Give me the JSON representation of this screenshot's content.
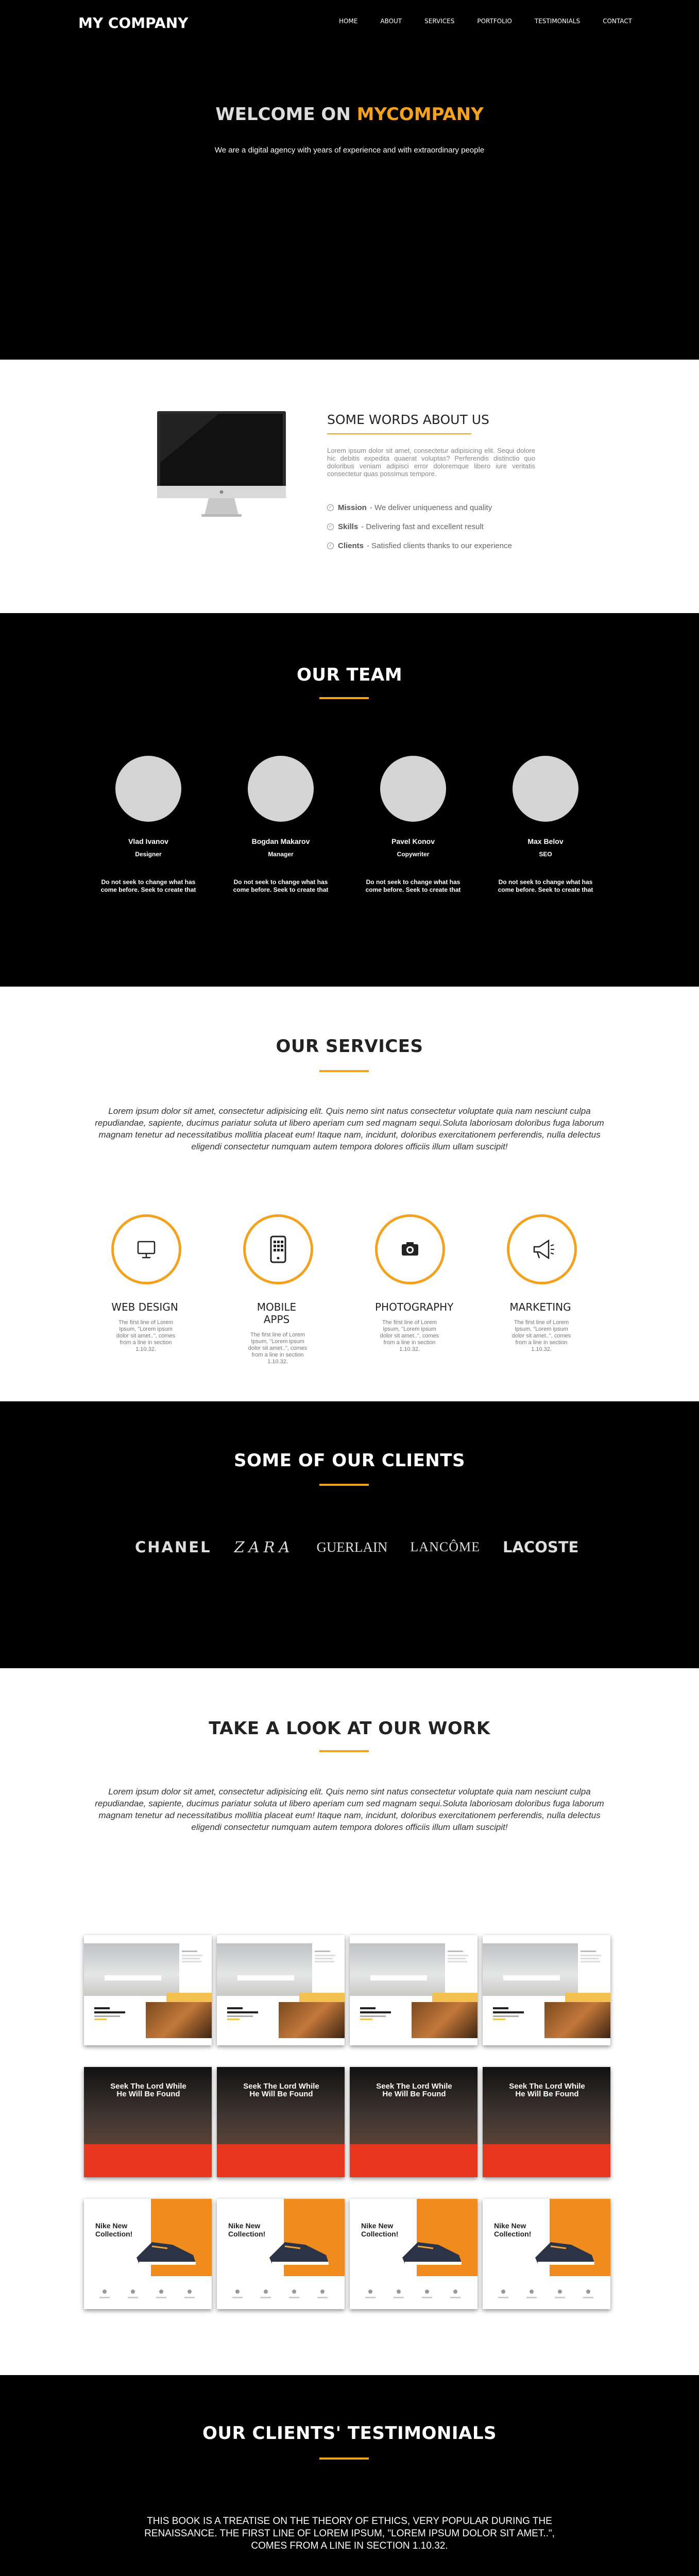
{
  "header": {
    "logo": "MY COMPANY",
    "nav": [
      "HOME",
      "ABOUT",
      "SERVICES",
      "PORTFOLIO",
      "TESTIMONIALS",
      "CONTACT"
    ]
  },
  "hero": {
    "title_prefix": "WELCOME ON ",
    "title_brand": "MYCOMPANY",
    "subtitle": "We are a digital agency with years of experience and with extraordinary people"
  },
  "about": {
    "heading": "SOME WORDS ABOUT US",
    "paragraph": "Lorem ipsum dolor sit amet, consectetur adipisicing elit. Sequi dolore hic debitis expedita quaerat voluptas? Perferendis distinctio quo doloribus veniam adipisci error doloremque libero iure veritatis consectetur quas possimus tempore.",
    "bullets": [
      {
        "label": "Mission",
        "text": "- We deliver uniqueness and quality"
      },
      {
        "label": "Skills",
        "text": "- Delivering fast and excellent result"
      },
      {
        "label": "Clients",
        "text": "- Satisfied clients thanks to our experience"
      }
    ]
  },
  "team": {
    "heading": "OUR TEAM",
    "members": [
      {
        "name": "Vlad Ivanov",
        "role": "Designer",
        "desc": "Do not seek to change what has come before. Seek to create that"
      },
      {
        "name": "Bogdan Makarov",
        "role": "Manager",
        "desc": "Do not seek to change what has come before. Seek to create that"
      },
      {
        "name": "Pavel Konov",
        "role": "Copywriter",
        "desc": "Do not seek to change what has come before. Seek to create that"
      },
      {
        "name": "Max Belov",
        "role": "SEO",
        "desc": "Do not seek to change what has come before. Seek to create that"
      }
    ]
  },
  "services": {
    "heading": "OUR SERVICES",
    "intro": "Lorem ipsum dolor sit amet, consectetur adipisicing elit. Quis nemo sint natus consectetur voluptate quia nam nesciunt culpa repudiandae, sapiente, ducimus pariatur soluta ut libero aperiam cum sed magnam sequi.Soluta laboriosam doloribus fuga laborum magnam tenetur ad necessitatibus mollitia placeat eum! Itaque nam, incidunt, doloribus exercitationem perferendis, nulla delectus eligendi consectetur numquam autem tempora dolores officiis illum ullam suscipit!",
    "items": [
      {
        "name": "WEB DESIGN",
        "icon": "monitor-icon",
        "desc": "The first line of Lorem Ipsum, \"Lorem ipsum dolor sit amet..\", comes from a line in section 1.10.32."
      },
      {
        "name": "MOBILE APPS",
        "icon": "smartphone-icon",
        "desc": "The first line of Lorem Ipsum, \"Lorem ipsum dolor sit amet..\", comes from a line in section 1.10.32."
      },
      {
        "name": "PHOTOGRAPHY",
        "icon": "camera-icon",
        "desc": "The first line of Lorem Ipsum, \"Lorem ipsum dolor sit amet..\", comes from a line in section 1.10.32."
      },
      {
        "name": "MARKETING",
        "icon": "megaphone-icon",
        "desc": "The first line of Lorem Ipsum, \"Lorem ipsum dolor sit amet..\", comes from a line in section 1.10.32."
      }
    ]
  },
  "clients": {
    "heading": "SOME OF OUR CLIENTS",
    "brands": [
      "CHANEL",
      "ZARA",
      "GUERLAIN",
      "LANCÔME",
      "LACOSTE"
    ]
  },
  "work": {
    "heading": "TAKE A LOOK AT OUR WORK",
    "intro": "Lorem ipsum dolor sit amet, consectetur adipisicing elit. Quis nemo sint natus consectetur voluptate quia nam nesciunt culpa repudiandae, sapiente, ducimus pariatur soluta ut libero aperiam cum sed magnam sequi.Soluta laboriosam doloribus fuga laborum magnam tenetur ad necessitatibus mollitia placeat eum! Itaque nam, incidunt, doloribus exercitationem perferendis, nulla delectus eligendi consectetur numquam autem tempora dolores officiis illum ullam suscipit!",
    "row2_headline": "Seek The Lord While He Will Be Found",
    "row3_headline": "Nike New Collection!"
  },
  "testimonials": {
    "heading": "OUR CLIENTS' TESTIMONIALS",
    "quote": "THIS BOOK IS A TREATISE ON THE THEORY OF ETHICS, VERY POPULAR DURING THE RENAISSANCE. THE FIRST LINE OF LOREM IPSUM, \"LOREM IPSUM DOLOR SIT AMET..\", COMES FROM A LINE IN SECTION 1.10.32."
  },
  "colors": {
    "accent": "#f4a21e",
    "dark": "#000000",
    "light": "#ffffff"
  }
}
